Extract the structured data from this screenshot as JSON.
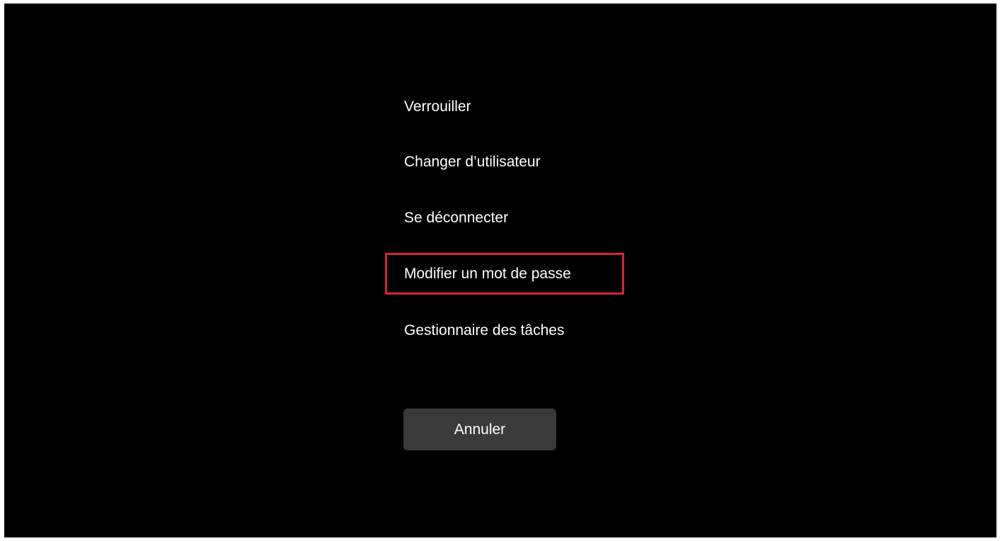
{
  "menu": {
    "items": [
      {
        "label": "Verrouiller"
      },
      {
        "label": "Changer d’utilisateur"
      },
      {
        "label": "Se déconnecter"
      },
      {
        "label": "Modifier un mot de passe",
        "highlighted": true
      },
      {
        "label": "Gestionnaire des tâches"
      }
    ]
  },
  "cancel": {
    "label": "Annuler"
  },
  "colors": {
    "background": "#000000",
    "text": "#ffffff",
    "highlight_border": "#d9232d",
    "button_background": "#3a3a3a"
  }
}
